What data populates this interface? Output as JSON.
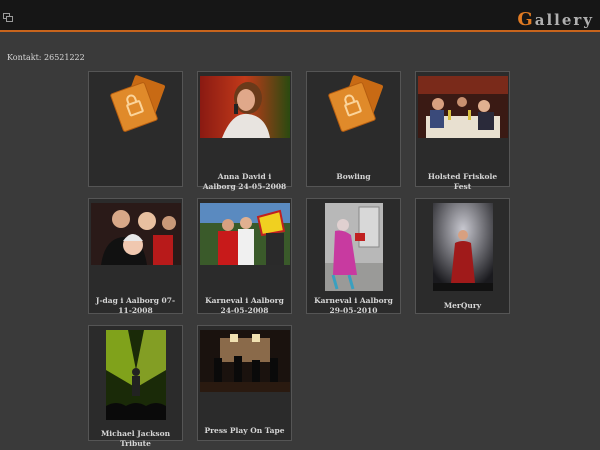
{
  "header": {
    "title_first": "G",
    "title_rest": "allery",
    "corner_icon": "windows-icon"
  },
  "contact": "Kontakt: 26521222",
  "albums": [
    {
      "caption": "",
      "icon": "lock-folder-icon"
    },
    {
      "caption": "Anna David i Aalborg 24-05-2008",
      "icon": "photo-singer"
    },
    {
      "caption": "Bowling",
      "icon": "lock-folder-icon"
    },
    {
      "caption": "Holsted Friskole Fest",
      "icon": "photo-party"
    },
    {
      "caption": "J-dag i Aalborg 07-11-2008",
      "icon": "photo-group"
    },
    {
      "caption": "Karneval i Aalborg 24-05-2008",
      "icon": "photo-carnival"
    },
    {
      "caption": "Karneval i Aalborg 29-05-2010",
      "icon": "photo-costume"
    },
    {
      "caption": "MerQury",
      "icon": "photo-stage"
    },
    {
      "caption": "Michael Jackson Tribute",
      "icon": "photo-tribute"
    },
    {
      "caption": "Press Play On Tape",
      "icon": "photo-band"
    }
  ],
  "colors": {
    "accent": "#e07a22",
    "background": "#3a3a3a",
    "tile": "#2b2b2b"
  }
}
